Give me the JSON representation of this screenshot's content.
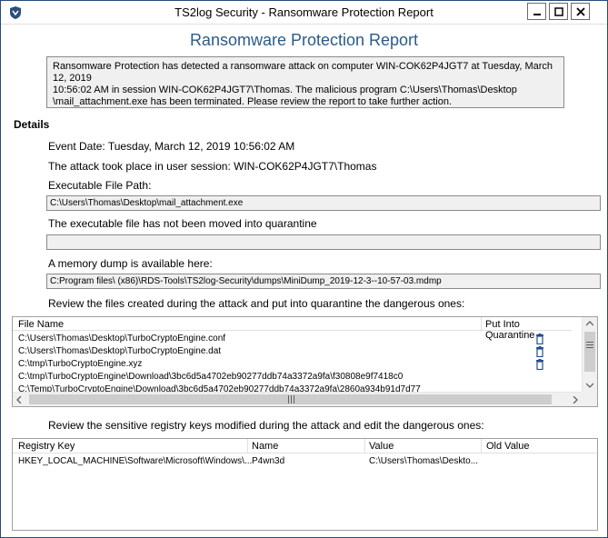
{
  "window": {
    "title": "TS2log Security -  Ransomware Protection Report"
  },
  "report": {
    "heading": "Ransomware Protection Report",
    "alert_line1": "Ransomware Protection has detected a ransomware attack on computer WIN-COK62P4JGT7 at Tuesday, March 12, 2019",
    "alert_line2": "10:56:02 AM in session WIN-COK62P4JGT7\\Thomas. The malicious program C:\\Users\\Thomas\\Desktop",
    "alert_line3": "\\mail_attachment.exe has been terminated. Please review the report to take further action."
  },
  "details": {
    "heading": "Details",
    "event_date": "Event Date: Tuesday, March 12, 2019 10:56:02 AM",
    "session": "The attack took place in user session: WIN-COK62P4JGT7\\Thomas",
    "exe_path_label": "Executable File Path:",
    "exe_path_value": "C:\\Users\\Thomas\\Desktop\\mail_attachment.exe",
    "quarantine_status": "The executable file has not been moved into quarantine",
    "quarantine_value": "",
    "dump_label": "A memory dump is available here:",
    "dump_value": "C:Program files\\ (x86)\\RDS-Tools\\TS2log-Security\\dumps\\MiniDump_2019-12-3--10-57-03.mdmp",
    "files_instruction": "Review the files created during the attack and put into quarantine the dangerous ones:",
    "registry_instruction": "Review the sensitive registry keys modified during the attack and edit the dangerous ones:"
  },
  "files_table": {
    "col_file": "File Name",
    "col_quarantine": "Put Into Quarantine",
    "rows": [
      "C:\\Users\\Thomas\\Desktop\\TurboCryptoEngine.conf",
      "C:\\Users\\Thomas\\Desktop\\TurboCryptoEngine.dat",
      "C:\\tmp\\TurboCryptoEngine.xyz",
      "C:\\tmp\\TurboCryptoEngine\\Download\\3bc6d5a4702eb90277ddb74a3372a9fa\\f30808e9f7418c0",
      "C:\\Temp\\TurboCryptoEngine\\Download\\3bc6d5a4702eb90277ddb74a3372a9fa\\2860a934b91d7d77"
    ]
  },
  "registry_table": {
    "col_key": "Registry Key",
    "col_name": "Name",
    "col_value": "Value",
    "col_old": "Old Value",
    "row_key": "HKEY_LOCAL_MACHINE\\Software\\Microsoft\\Windows\\...",
    "row_name": "P4wn3d",
    "row_value": "C:\\Users\\Thomas\\Deskto...",
    "row_old": ""
  },
  "icons": [
    "shield-icon",
    "minimize-icon",
    "maximize-icon",
    "close-icon",
    "trash-icon",
    "chevron-up-icon",
    "chevron-down-icon",
    "chevron-left-icon",
    "chevron-right-icon"
  ],
  "colors": {
    "heading": "#2b5b8a",
    "field_bg": "#f0f0f0",
    "window_border": "#2a4a7a"
  }
}
